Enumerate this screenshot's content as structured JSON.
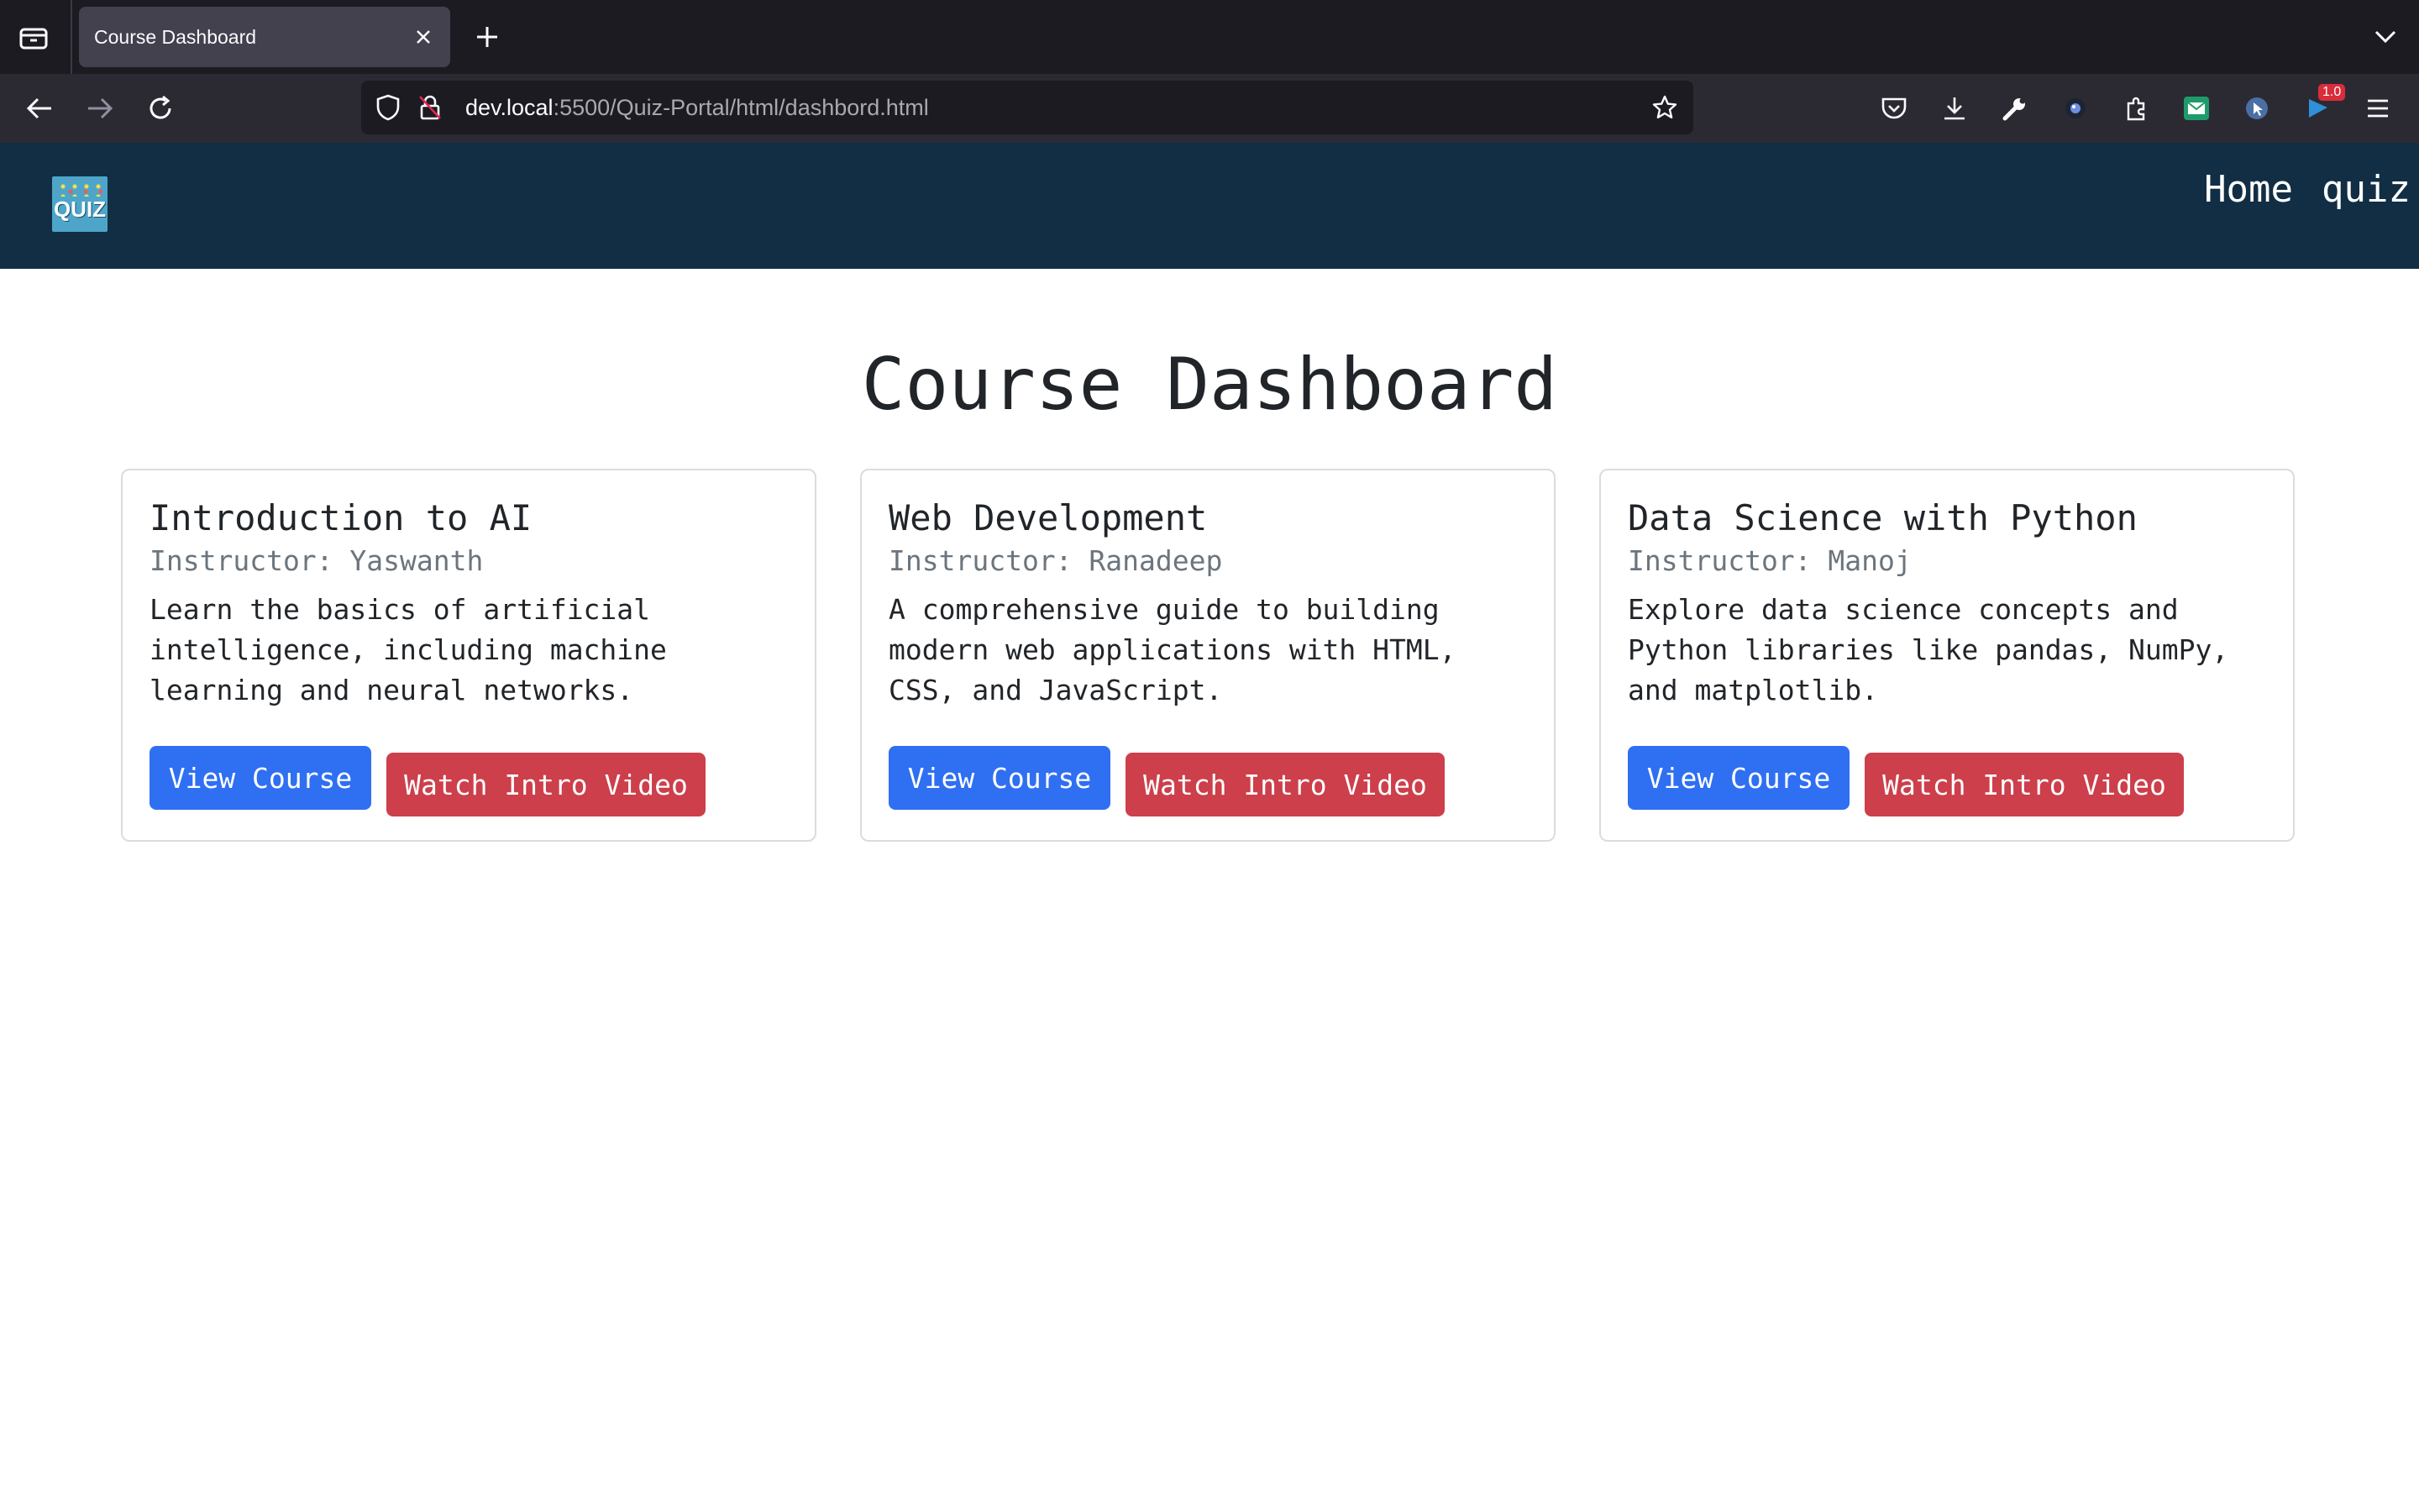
{
  "browser": {
    "tab_title": "Course Dashboard",
    "url_host": "dev.local",
    "url_rest": ":5500/Quiz-Portal/html/dashbord.html",
    "extension_badge": "1.0"
  },
  "site": {
    "logo_text": "QUIZ",
    "nav": [
      {
        "label": "Home"
      },
      {
        "label": "quiz"
      }
    ]
  },
  "page": {
    "title": "Course Dashboard"
  },
  "courses": [
    {
      "title": "Introduction to AI",
      "instructor": "Instructor: Yaswanth",
      "description": "Learn the basics of artificial intelligence, including machine learning and neural networks.",
      "view_label": "View Course",
      "video_label": "Watch Intro Video"
    },
    {
      "title": "Web Development",
      "instructor": "Instructor: Ranadeep",
      "description": "A comprehensive guide to building modern web applications with HTML, CSS, and JavaScript.",
      "view_label": "View Course",
      "video_label": "Watch Intro Video"
    },
    {
      "title": "Data Science with Python",
      "instructor": "Instructor: Manoj",
      "description": "Explore data science concepts and Python libraries like pandas, NumPy, and matplotlib.",
      "view_label": "View Course",
      "video_label": "Watch Intro Video"
    }
  ],
  "colors": {
    "header_bg": "#112e44",
    "view_button": "#2f6ff2",
    "video_button": "#cc3f4b"
  },
  "icons": [
    "tab-list-icon",
    "close-icon",
    "plus-icon",
    "chevron-down-icon",
    "back-arrow-icon",
    "forward-arrow-icon",
    "reload-icon",
    "shield-icon",
    "insecure-lock-icon",
    "star-icon",
    "pocket-icon",
    "download-icon",
    "wrench-icon",
    "extension-puzzle-icon",
    "menu-icon"
  ]
}
